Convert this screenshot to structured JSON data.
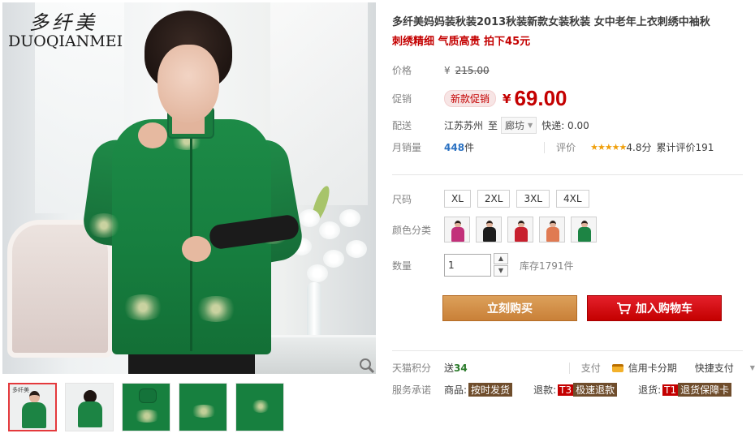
{
  "brand": {
    "logo_cn": "多纤美",
    "logo_en": "DUOQIANMEI"
  },
  "gallery": {
    "thumb_logo": "多纤美"
  },
  "product": {
    "title": "多纤美妈妈装秋装2013秋装新款女装秋装 女中老年上衣刺绣中袖秋",
    "subtitle": "刺绣精细 气质高贵 拍下45元"
  },
  "price": {
    "label": "价格",
    "currency": "¥",
    "original": "215.00",
    "promo_label": "促销",
    "promo_tag": "新款促销",
    "promo_price": "69.00"
  },
  "shipping": {
    "label": "配送",
    "from": "江苏苏州",
    "to_label": "至",
    "destination": "廊坊",
    "express": "快递: 0.00"
  },
  "sales": {
    "label": "月销量",
    "count": "448",
    "unit": "件",
    "rating_label": "评价",
    "stars": "★★★★★",
    "score": "4.8分",
    "reviews": "累计评价191",
    "rating_value": 4.8
  },
  "sku": {
    "size_label": "尺码",
    "sizes": [
      "XL",
      "2XL",
      "3XL",
      "4XL"
    ],
    "color_label": "颜色分类",
    "colors": [
      "#c2317a",
      "#1d1d1d",
      "#c8202e",
      "#e07a52",
      "#1d8444"
    ]
  },
  "quantity": {
    "label": "数量",
    "value": "1",
    "up": "▲",
    "down": "▼",
    "stock": "库存1791件"
  },
  "actions": {
    "buy": "立刻购买",
    "cart": "加入购物车"
  },
  "points": {
    "label": "天猫积分",
    "send": "送",
    "value": "34",
    "pay_label": "支付",
    "card": "信用卡分期",
    "quick": "快捷支付",
    "more": "▼"
  },
  "service": {
    "label": "服务承诺",
    "goods_label": "商品:",
    "goods_tag": "按时发货",
    "refund_label": "退款:",
    "refund_code": "T3",
    "refund_tag": "极速退款",
    "return_label": "退货:",
    "return_code": "T1",
    "return_tag": "退货保障卡"
  },
  "colors": {
    "accent": "#c40000",
    "buy": "#d08a40",
    "cart": "#c40000",
    "link": "#2a71c2"
  }
}
